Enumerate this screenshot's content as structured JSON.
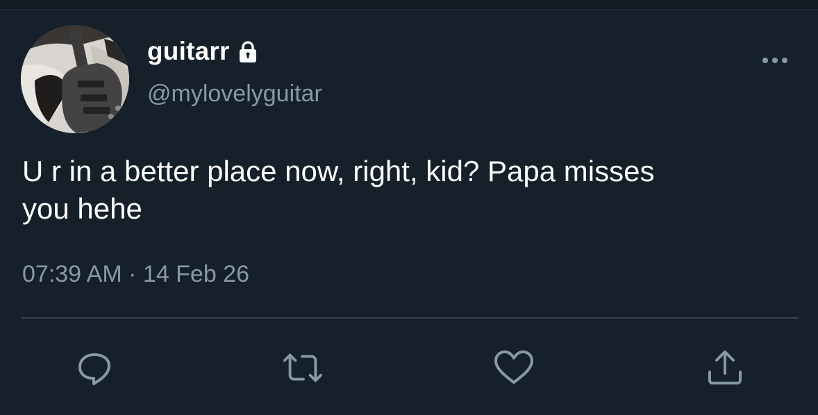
{
  "tweet": {
    "display_name": "guitarr",
    "handle": "@mylovelyguitar",
    "protected_icon": "lock-icon",
    "text": "U r in a better place now, right, kid? Papa misses\nyou hehe",
    "time": "07:39 AM",
    "separator": " · ",
    "date": "14 Feb 26"
  },
  "actions": [
    {
      "icon": "reply-icon"
    },
    {
      "icon": "retweet-icon"
    },
    {
      "icon": "like-icon"
    },
    {
      "icon": "share-icon"
    }
  ],
  "colors": {
    "background": "#15202b",
    "primary_text": "#ffffff",
    "secondary_text": "#8899a6",
    "divider": "#38444d",
    "icon": "#8899a6"
  }
}
